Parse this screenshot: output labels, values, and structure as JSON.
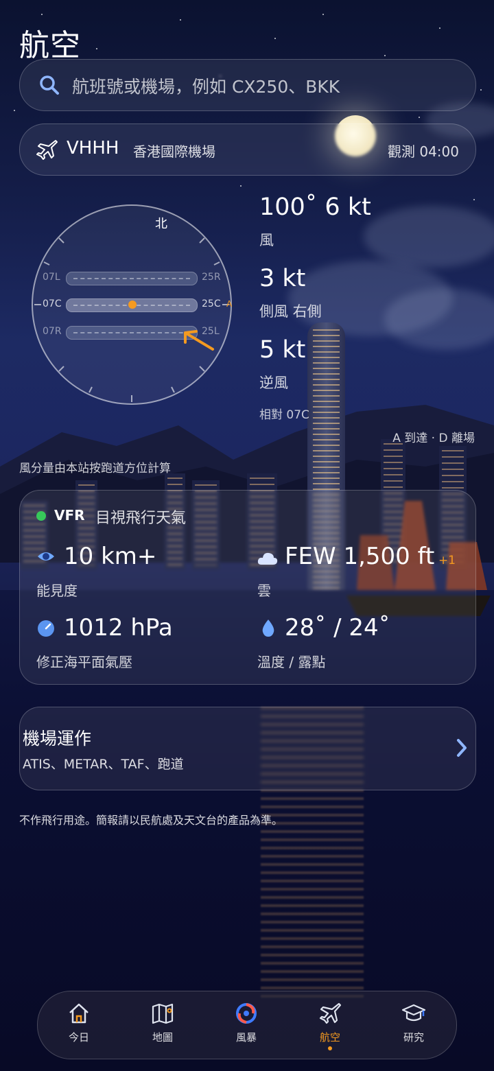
{
  "page_title": "航空",
  "search": {
    "placeholder": "航班號或機場，例如 CX250、BKK",
    "icon": "search-icon"
  },
  "airport": {
    "icao": "VHHH",
    "name": "香港國際機場",
    "observation": "觀測 04:00"
  },
  "runways": {
    "north_label": "北",
    "rows": [
      {
        "left": "07L",
        "right": "25R"
      },
      {
        "left": "07C",
        "right": "25C",
        "flag": "A"
      },
      {
        "left": "07R",
        "right": "25L"
      }
    ]
  },
  "wind": {
    "main_value": "100˚ 6 kt",
    "main_label": "風",
    "crosswind_value": "3 kt",
    "crosswind_label": "側風 右側",
    "headwind_value": "5 kt",
    "headwind_label": "逆風",
    "relative": "相對 07C",
    "legend": "A 到達 · D 離場",
    "note": "風分量由本站按跑道方位計算"
  },
  "weather": {
    "category": "VFR",
    "category_desc": "目視飛行天氣",
    "category_color": "#37c85a",
    "visibility_value": "10 km+",
    "visibility_label": "能見度",
    "cloud_value": "FEW 1,500 ft",
    "cloud_extra": "+1",
    "cloud_label": "雲",
    "pressure_value": "1012 hPa",
    "pressure_label": "修正海平面氣壓",
    "temp_value": "28˚ / 24˚",
    "temp_label": "溫度 / 露點"
  },
  "operations": {
    "title": "機場運作",
    "subtitle": "ATIS、METAR、TAF、跑道"
  },
  "disclaimer": "不作飛行用途。簡報請以民航處及天文台的產品為準。",
  "nav": [
    {
      "label": "今日",
      "icon": "home-icon"
    },
    {
      "label": "地圖",
      "icon": "map-icon"
    },
    {
      "label": "風暴",
      "icon": "storm-icon"
    },
    {
      "label": "航空",
      "icon": "plane-icon",
      "active": true
    },
    {
      "label": "研究",
      "icon": "graduation-cap-icon"
    }
  ],
  "accent_color": "#f49a20"
}
